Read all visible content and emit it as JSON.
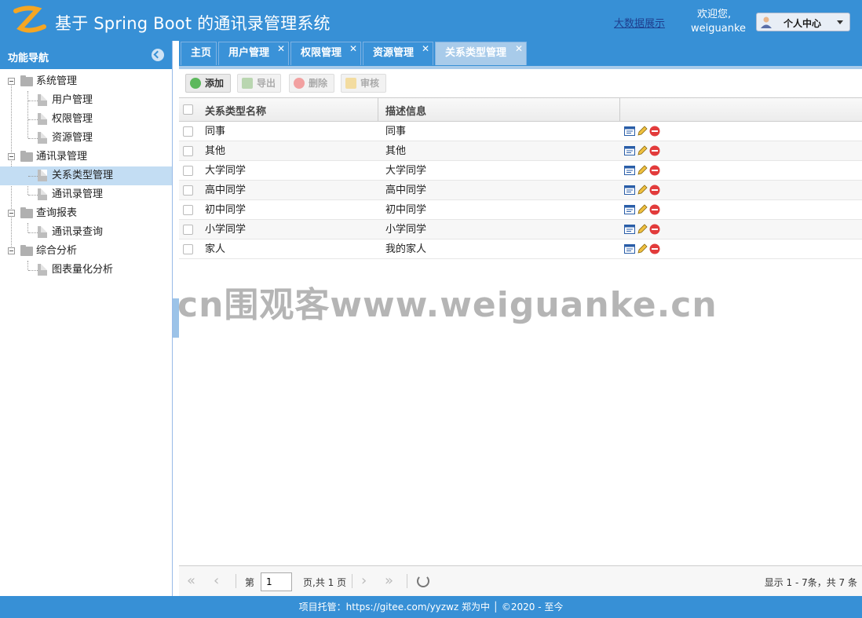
{
  "header": {
    "title": "基于 Spring Boot 的通讯录管理系统",
    "bigdata_link": "大数据展示",
    "welcome_line1": "欢迎您,",
    "welcome_user": "weiguanke",
    "user_menu_label": "个人中心"
  },
  "sidebar": {
    "title": "功能导航",
    "groups": [
      {
        "label": "系统管理",
        "items": [
          "用户管理",
          "权限管理",
          "资源管理"
        ]
      },
      {
        "label": "通讯录管理",
        "items": [
          "关系类型管理",
          "通讯录管理"
        ]
      },
      {
        "label": "查询报表",
        "items": [
          "通讯录查询"
        ]
      },
      {
        "label": "综合分析",
        "items": [
          "图表量化分析"
        ]
      }
    ],
    "selected_item": "关系类型管理"
  },
  "tabs": [
    {
      "label": "主页",
      "closable": false
    },
    {
      "label": "用户管理",
      "closable": true
    },
    {
      "label": "权限管理",
      "closable": true
    },
    {
      "label": "资源管理",
      "closable": true
    },
    {
      "label": "关系类型管理",
      "closable": true,
      "active": true
    }
  ],
  "toolbar": {
    "add": "添加",
    "export": "导出",
    "delete": "删除",
    "audit": "审核"
  },
  "grid": {
    "columns": [
      "关系类型名称",
      "描述信息",
      ""
    ],
    "rows": [
      {
        "name": "同事",
        "desc": "同事"
      },
      {
        "name": "其他",
        "desc": "其他"
      },
      {
        "name": "大学同学",
        "desc": "大学同学"
      },
      {
        "name": "高中同学",
        "desc": "高中同学"
      },
      {
        "name": "初中同学",
        "desc": "初中同学"
      },
      {
        "name": "小学同学",
        "desc": "小学同学"
      },
      {
        "name": "家人",
        "desc": "我的家人"
      }
    ]
  },
  "pager": {
    "page_prefix": "第",
    "page_value": "1",
    "page_suffix": "页,共 1 页",
    "summary": "显示 1 - 7条，共 7 条"
  },
  "footer": {
    "text": "项目托管：https://gitee.com/yyzwz 郑为中 │ ©2020 - 至今"
  },
  "watermark": "cn围观客www.weiguanke.cn",
  "colors": {
    "primary": "#3790d6",
    "tab_active": "#a8cbea",
    "selected_row": "#c3ddf3"
  }
}
